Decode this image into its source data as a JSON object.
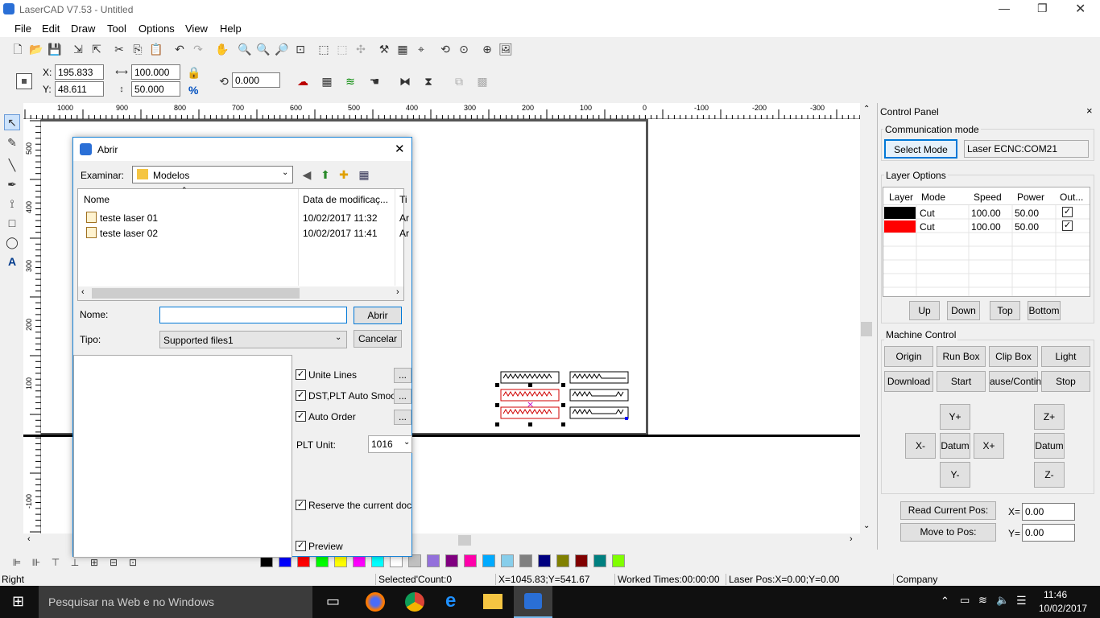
{
  "window": {
    "title": "LaserCAD V7.53 - Untitled"
  },
  "menu": [
    "File",
    "Edit",
    "Draw",
    "Tool",
    "Options",
    "View",
    "Help"
  ],
  "props": {
    "x_label": "X:",
    "x_value": "195.833",
    "y_label": "Y:",
    "y_value": "48.611",
    "w_value": "100.000",
    "h_value": "50.000",
    "pct": "%",
    "rot_value": "0.000"
  },
  "ruler_top": [
    "1000",
    "900",
    "800",
    "700",
    "600",
    "500",
    "400",
    "300",
    "200",
    "100",
    "0",
    "-100",
    "-200",
    "-300"
  ],
  "ruler_left": [
    "500",
    "400",
    "300",
    "200",
    "100",
    "-100"
  ],
  "dialog": {
    "title": "Abrir",
    "look_label": "Examinar:",
    "look_value": "Modelos",
    "columns": [
      "Nome",
      "Data de modificaç...",
      "Ti"
    ],
    "files": [
      {
        "name": "teste laser 01",
        "date": "10/02/2017 11:32",
        "type": "Ar"
      },
      {
        "name": "teste laser 02",
        "date": "10/02/2017 11:41",
        "type": "Ar"
      }
    ],
    "name_label": "Nome:",
    "name_value": "",
    "open": "Abrir",
    "type_label": "Tipo:",
    "type_value": "Supported files1",
    "cancel": "Cancelar",
    "opt_unite": "Unite Lines",
    "opt_dst": "DST,PLT Auto Smoot",
    "opt_auto": "Auto Order",
    "plt_label": "PLT Unit:",
    "plt_value": "1016",
    "opt_reserve": "Reserve the current docme",
    "opt_preview": "Preview",
    "dots": "..."
  },
  "control_panel": {
    "title": "Control Panel",
    "comm_label": "Communication mode",
    "select_mode": "Select Mode",
    "comm_value": "Laser ECNC:COM21",
    "layer_label": "Layer Options",
    "layer_cols": [
      "Layer",
      "Mode",
      "Speed",
      "Power",
      "Out..."
    ],
    "layers": [
      {
        "color": "#000000",
        "mode": "Cut",
        "speed": "100.00",
        "power": "50.00",
        "out": "✓"
      },
      {
        "color": "#ff0000",
        "mode": "Cut",
        "speed": "100.00",
        "power": "50.00",
        "out": "✓"
      }
    ],
    "order_btns": [
      "Up",
      "Down",
      "Top",
      "Bottom"
    ],
    "machine_label": "Machine Control",
    "mc_row1": [
      "Origin",
      "Run Box",
      "Clip Box",
      "Light"
    ],
    "mc_row2": [
      "Download",
      "Start",
      "ause/Continu",
      "Stop"
    ],
    "jog": {
      "yp": "Y+",
      "xm": "X-",
      "datum": "Datum",
      "xp": "X+",
      "ym": "Y-",
      "zp": "Z+",
      "zdatum": "Datum",
      "zm": "Z-"
    },
    "read_pos": "Read Current Pos:",
    "move_to": "Move to Pos:",
    "x_label": "X=",
    "x_val": "0.00",
    "y_label": "Y=",
    "y_val": "0.00"
  },
  "palette": [
    "#000000",
    "#0000ff",
    "#ff0000",
    "#00ff00",
    "#ffff00",
    "#ff00ff",
    "#00ffff",
    "#ffffff",
    "#c0c0c0",
    "#9370db",
    "#800080",
    "#ff00aa",
    "#00aaff",
    "#87ceeb",
    "#808080",
    "#000080",
    "#808000",
    "#800000",
    "#008080",
    "#80ff00"
  ],
  "status": {
    "left": "Right",
    "selected": "Selected'Count:0",
    "coords": "X=1045.83;Y=541.67",
    "worked": "Worked Times:00:00:00",
    "laserpos": "Laser Pos:X=0.00;Y=0.00",
    "company": "Company"
  },
  "taskbar": {
    "search": "Pesquisar na Web e no Windows",
    "time": "11:46",
    "date": "10/02/2017"
  }
}
